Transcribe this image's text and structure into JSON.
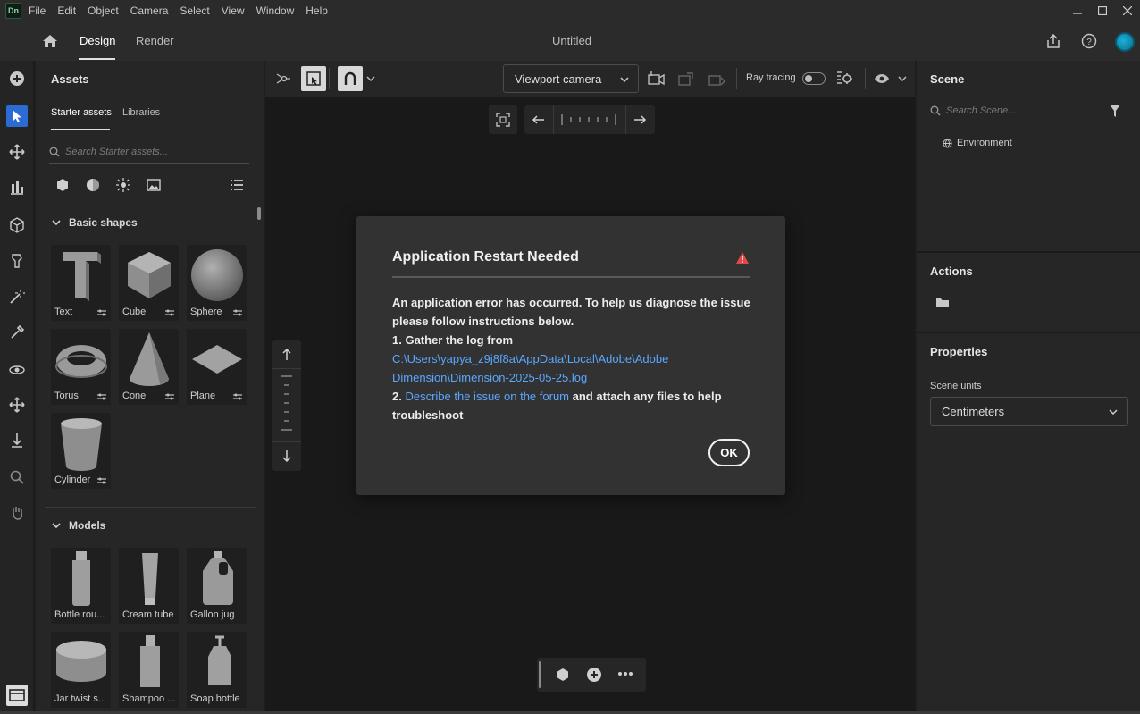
{
  "app": {
    "logo": "Dn",
    "menu": [
      "File",
      "Edit",
      "Object",
      "Camera",
      "Select",
      "View",
      "Window",
      "Help"
    ],
    "tabs": [
      "Design",
      "Render"
    ],
    "document_title": "Untitled"
  },
  "assets": {
    "title": "Assets",
    "subtabs": [
      "Starter assets",
      "Libraries"
    ],
    "search_placeholder": "Search Starter assets...",
    "basic_shapes_label": "Basic shapes",
    "basic_shapes": [
      "Text",
      "Cube",
      "Sphere",
      "Torus",
      "Cone",
      "Plane",
      "Cylinder"
    ],
    "models_label": "Models",
    "models": [
      "Bottle rou...",
      "Cream tube",
      "Gallon jug",
      "Jar twist s...",
      "Shampoo ...",
      "Soap bottle"
    ]
  },
  "viewport": {
    "camera_select": "Viewport camera",
    "ray_tracing_label": "Ray tracing",
    "ray_tracing_on": false
  },
  "scene": {
    "title": "Scene",
    "search_placeholder": "Search Scene...",
    "environment_label": "Environment"
  },
  "actions": {
    "title": "Actions"
  },
  "properties": {
    "title": "Properties",
    "scene_units_label": "Scene units",
    "scene_units_value": "Centimeters"
  },
  "dialog": {
    "title": "Application Restart Needed",
    "line1": "An application error has occurred. To help us diagnose the issue please follow instructions below.",
    "step1": "1. Gather the log from",
    "log_path_1": "C:\\Users\\yapya_z9j8f8a\\AppData\\Local\\Adobe\\Adobe",
    "log_path_2": "Dimension\\Dimension-2025-05-25.log",
    "step2_prefix": "2.",
    "forum_link": "Describe the issue on the forum",
    "step2_suffix": "and attach any files to help troubleshoot",
    "ok_label": "OK"
  },
  "colors": {
    "accent": "#2c6bd4",
    "link": "#5aa7ff",
    "warning": "#e04848"
  }
}
